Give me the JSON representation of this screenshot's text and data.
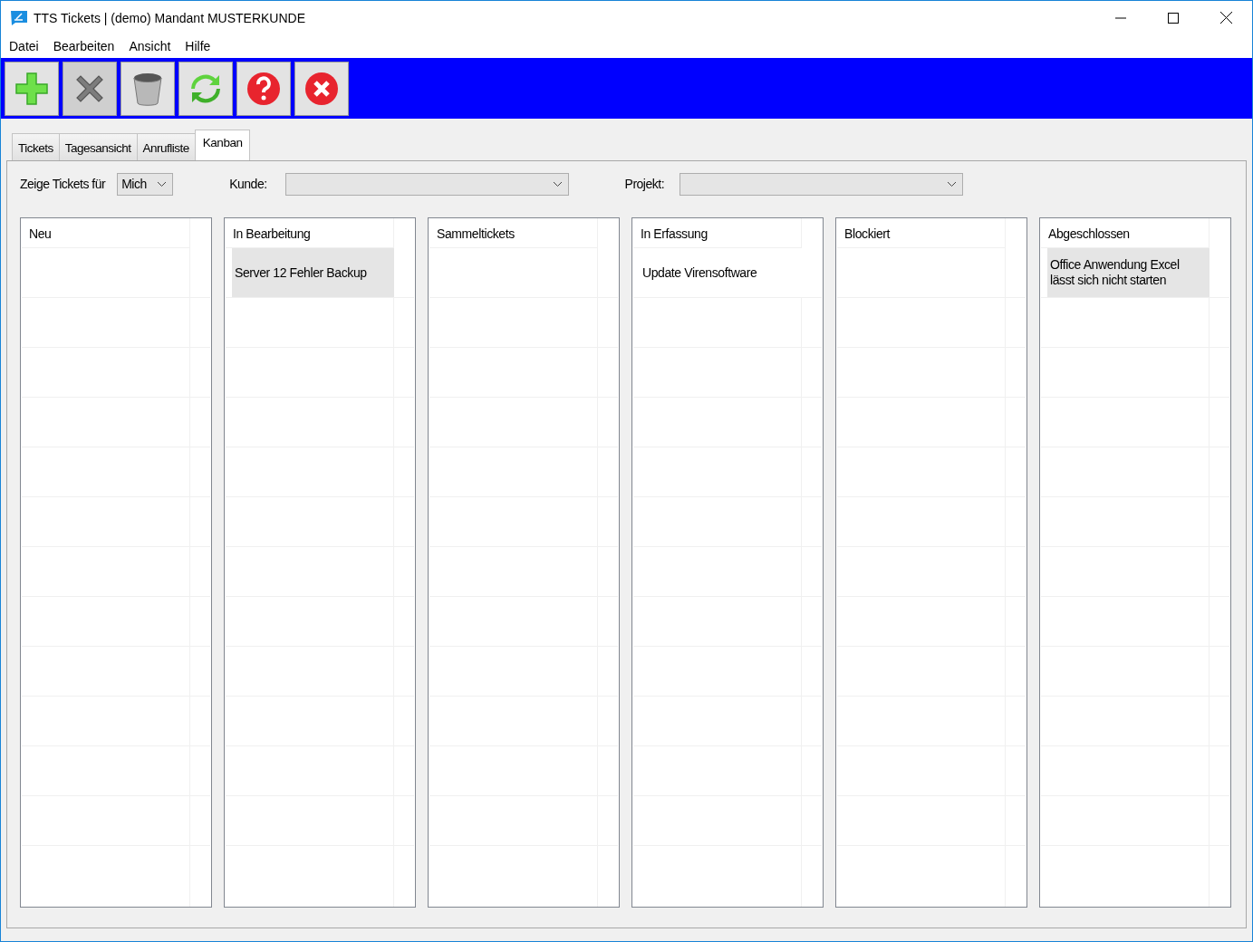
{
  "window": {
    "title": "TTS Tickets | (demo) Mandant MUSTERKUNDE"
  },
  "menu": [
    "Datei",
    "Bearbeiten",
    "Ansicht",
    "Hilfe"
  ],
  "toolbar": [
    {
      "kind": "add"
    },
    {
      "kind": "cancel"
    },
    {
      "kind": "trash"
    },
    {
      "kind": "refresh"
    },
    {
      "kind": "help"
    },
    {
      "kind": "exit"
    }
  ],
  "tabs": [
    {
      "label": "Tickets",
      "selected": false
    },
    {
      "label": "Tagesansicht",
      "selected": false
    },
    {
      "label": "Anrufliste",
      "selected": false
    },
    {
      "label": "Kanban",
      "selected": true
    }
  ],
  "filters": {
    "show_label": "Zeige Tickets für",
    "show_value": "Mich",
    "customer_label": "Kunde:",
    "project_label": "Projekt:"
  },
  "columns": [
    {
      "title": "Neu"
    },
    {
      "title": "In Bearbeitung",
      "cards": [
        {
          "text": "Server 12 Fehler Backup",
          "selected": true
        }
      ]
    },
    {
      "title": "Sammeltickets"
    },
    {
      "title": "In Erfassung",
      "cards": [
        {
          "text": "Update Virensoftware",
          "selected": false
        }
      ]
    },
    {
      "title": "Blockiert"
    },
    {
      "title": "Abgeschlossen",
      "cards": [
        {
          "text": "Office Anwendung Excel lässt sich nicht starten",
          "selected": true
        }
      ]
    }
  ]
}
